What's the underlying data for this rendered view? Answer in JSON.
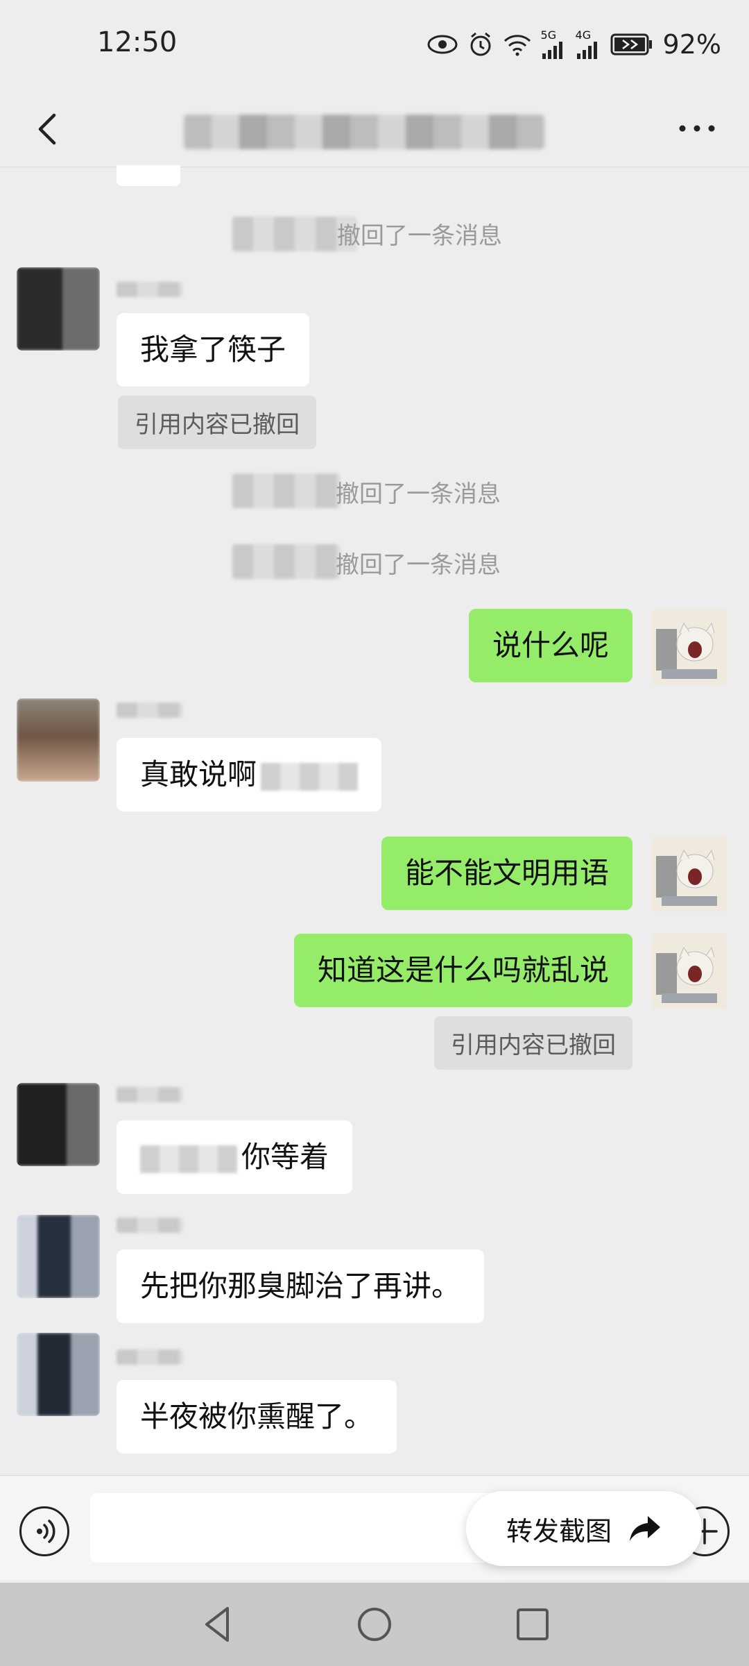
{
  "status_bar": {
    "time": "12:50",
    "net1": "5G",
    "net2": "4G",
    "battery": "92%"
  },
  "header": {
    "title": "",
    "back_icon": "chevron-left-icon",
    "more_icon": "more-horizontal-icon"
  },
  "messages": {
    "recall_1": "撤回了一条消息",
    "m1_text": "我拿了筷子",
    "m1_quote": "引用内容已撤回",
    "recall_2": "撤回了一条消息",
    "recall_3": "撤回了一条消息",
    "m2_text": "说什么呢",
    "m3_text": "真敢说啊",
    "m4_text": "能不能文明用语",
    "m5_text": "知道这是什么吗就乱说",
    "m5_quote": "引用内容已撤回",
    "m6_text": "你等着",
    "m7_text": "先把你那臭脚治了再讲。",
    "m8_text": "半夜被你熏醒了。"
  },
  "forward_button": {
    "label": "转发截图",
    "icon": "share-arrow-icon"
  },
  "colors": {
    "background": "#ededed",
    "outgoing_bubble": "#95ec69",
    "incoming_bubble": "#ffffff"
  }
}
